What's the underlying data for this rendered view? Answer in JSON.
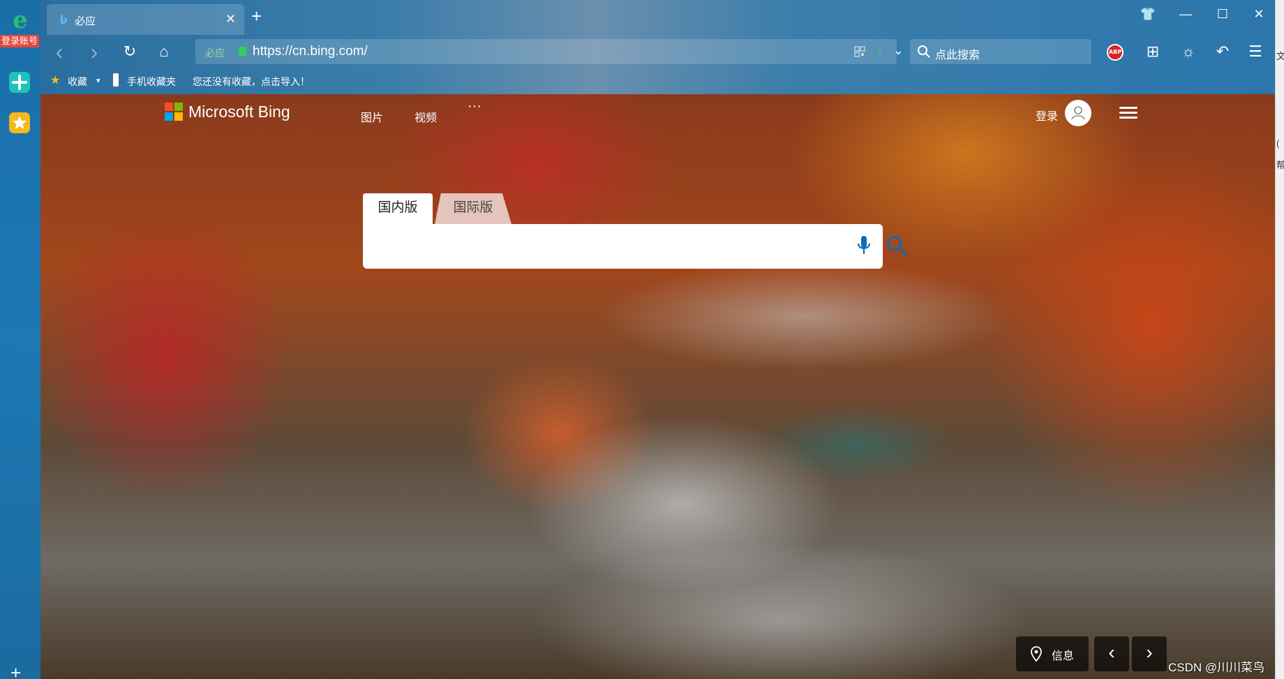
{
  "sidebar": {
    "logo_glyph": "e",
    "login_label": "登录账号",
    "plus_glyph": "+"
  },
  "tabs": [
    {
      "title": "必应",
      "close_glyph": "✕"
    }
  ],
  "newtab_glyph": "+",
  "window_controls": {
    "skin": "👕",
    "minimize": "—",
    "maximize": "☐",
    "close": "✕"
  },
  "toolbar": {
    "back": "‹",
    "forward": "›",
    "refresh": "↻",
    "home": "⌂",
    "site_name": "必应",
    "url": "https://cn.bing.com/",
    "dropdown": "⌄",
    "search_placeholder": "点此搜索",
    "abp_label": "ABP",
    "grid": "⊞",
    "theme": "☼",
    "undo": "↶",
    "menu": "☰"
  },
  "bookmarks": {
    "favorites": "收藏",
    "favorites_drop": "▾",
    "mobile": "手机收藏夹",
    "hint": "您还没有收藏，点击导入！"
  },
  "bing": {
    "brand": "Microsoft Bing",
    "nav": [
      "图片",
      "视频"
    ],
    "more": "···",
    "signin": "登录",
    "search_tabs": [
      "国内版",
      "国际版"
    ],
    "info_label": "信息",
    "prev": "‹",
    "next": "›"
  },
  "watermark": "CSDN @川川菜鸟",
  "right_strip": [
    "文",
    "(",
    "帮"
  ],
  "colors": {
    "ms_red": "#f25022",
    "ms_green": "#7fba00",
    "ms_blue": "#00a4ef",
    "ms_yellow": "#ffb900",
    "accent_blue": "#0e6ab3"
  }
}
